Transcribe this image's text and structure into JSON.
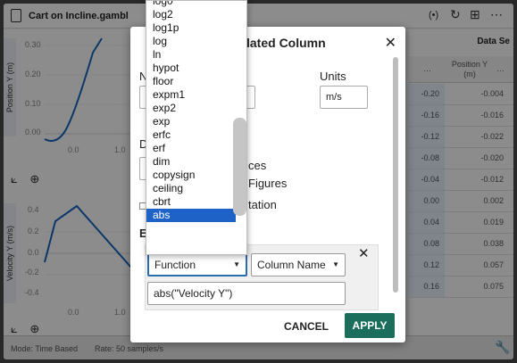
{
  "app": {
    "file_name": "Cart on Incline.gambl",
    "data_set_title": "Data Se"
  },
  "graph1": {
    "axis_label": "Position Y (m)",
    "y_ticks": [
      "0.30",
      "0.20",
      "0.10",
      "0.00"
    ],
    "x_ticks": [
      "0.0",
      "1.0"
    ]
  },
  "graph2": {
    "axis_label": "Velocity Y (m/s)",
    "y_ticks": [
      "0.4",
      "0.2",
      "0.0",
      "-0.2",
      "-0.4"
    ],
    "x_ticks": [
      "0.0",
      "1.0"
    ]
  },
  "table": {
    "column2_header": "Position Y (m)",
    "column_menu": "…",
    "rows": [
      {
        "c1": "-0.20",
        "c2": "-0.004"
      },
      {
        "c1": "-0.16",
        "c2": "-0.016"
      },
      {
        "c1": "-0.12",
        "-c2": "",
        "c2": "-0.022"
      },
      {
        "c1": "-0.08",
        "c2": "-0.020"
      },
      {
        "c1": "-0.04",
        "c2": "-0.012"
      },
      {
        "c1": "0.00",
        "c2": "0.002"
      },
      {
        "c1": "0.04",
        "c2": "0.019"
      },
      {
        "c1": "0.08",
        "c2": "0.038"
      },
      {
        "c1": "0.12",
        "c2": "0.057"
      },
      {
        "c1": "0.16",
        "c2": "0.075"
      }
    ]
  },
  "status": {
    "mode": "Mode: Time Based",
    "rate": "Rate: 50 samples/s"
  },
  "dialog": {
    "title": "lated Column",
    "units_label": "Units",
    "units_value": "m/s",
    "name_label_partial": "N",
    "decimal_label_partial": "D",
    "expr_label_partial": "E",
    "opt_places_partial": "ces",
    "opt_figures_partial": "Figures",
    "opt_notation_partial": "tation",
    "function_select": "Function",
    "column_select": "Column Name",
    "expression": "abs(\"Velocity Y\")",
    "cancel": "CANCEL",
    "apply": "APPLY"
  },
  "dropdown": {
    "options": [
      "log0",
      "log2",
      "log1p",
      "log",
      "ln",
      "hypot",
      "floor",
      "expm1",
      "exp2",
      "exp",
      "erfc",
      "erf",
      "dim",
      "copysign",
      "ceiling",
      "cbrt",
      "abs"
    ],
    "selected": "abs"
  },
  "colors": {
    "curve": "#1565c0",
    "apply_button": "#1a6e5b",
    "selected_option": "#1e62c8"
  }
}
